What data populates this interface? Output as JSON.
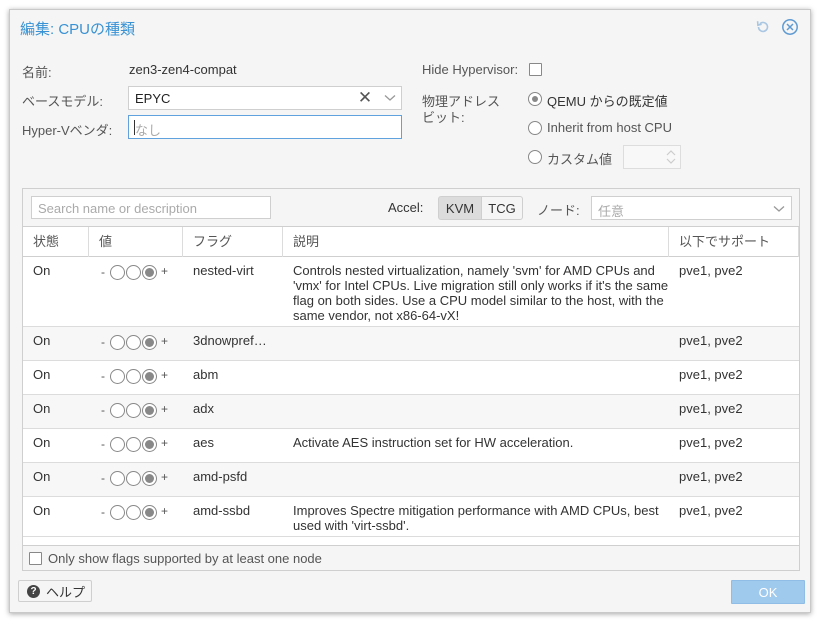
{
  "window": {
    "title": "編集: CPUの種類"
  },
  "form": {
    "name_label": "名前:",
    "name_value": "zen3-zen4-compat",
    "base_model_label": "ベースモデル:",
    "base_model_value": "EPYC",
    "hyperv_vendor_label": "Hyper-Vベンダ:",
    "hyperv_vendor_placeholder": "なし",
    "hide_hypervisor_label": "Hide Hypervisor:",
    "hide_hypervisor_checked": false,
    "phys_bits_label_line1": "物理アドレス",
    "phys_bits_label_line2": "ビット:",
    "phys_bits_options": [
      {
        "label": "QEMU からの既定値",
        "checked": true
      },
      {
        "label": "Inherit from host CPU",
        "checked": false
      },
      {
        "label": "カスタム値",
        "checked": false
      }
    ]
  },
  "grid": {
    "search_placeholder": "Search name or description",
    "accel_label": "Accel:",
    "accel_options": [
      "KVM",
      "TCG"
    ],
    "accel_selected": "KVM",
    "node_label": "ノード:",
    "node_placeholder": "任意",
    "columns": [
      "状態",
      "値",
      "フラグ",
      "説明",
      "以下でサポート"
    ],
    "rows": [
      {
        "state": "On",
        "flag": "nested-virt",
        "description": "Controls nested virtualization, namely 'svm' for AMD CPUs and 'vmx' for Intel CPUs. Live migration still only works if it's the same flag on both sides. Use a CPU model similar to the host, with the same vendor, not x86-64-vX!",
        "supported": "pve1, pve2"
      },
      {
        "state": "On",
        "flag": "3dnowpref…",
        "description": "",
        "supported": "pve1, pve2"
      },
      {
        "state": "On",
        "flag": "abm",
        "description": "",
        "supported": "pve1, pve2"
      },
      {
        "state": "On",
        "flag": "adx",
        "description": "",
        "supported": "pve1, pve2"
      },
      {
        "state": "On",
        "flag": "aes",
        "description": "Activate AES instruction set for HW acceleration.",
        "supported": "pve1, pve2"
      },
      {
        "state": "On",
        "flag": "amd-psfd",
        "description": "",
        "supported": "pve1, pve2"
      },
      {
        "state": "On",
        "flag": "amd-ssbd",
        "description": "Improves Spectre mitigation performance with AMD CPUs, best used with 'virt-ssbd'.",
        "supported": "pve1, pve2"
      }
    ],
    "tristate": {
      "minus": "-",
      "plus": "+"
    },
    "footer_checkbox_label": "Only show flags supported by at least one node"
  },
  "buttons": {
    "help_icon": "question-circle-icon",
    "help_label": "ヘルプ",
    "ok_label": "OK"
  },
  "colors": {
    "accent": "#3892d4",
    "ok_disabled": "#a0c9ee"
  }
}
